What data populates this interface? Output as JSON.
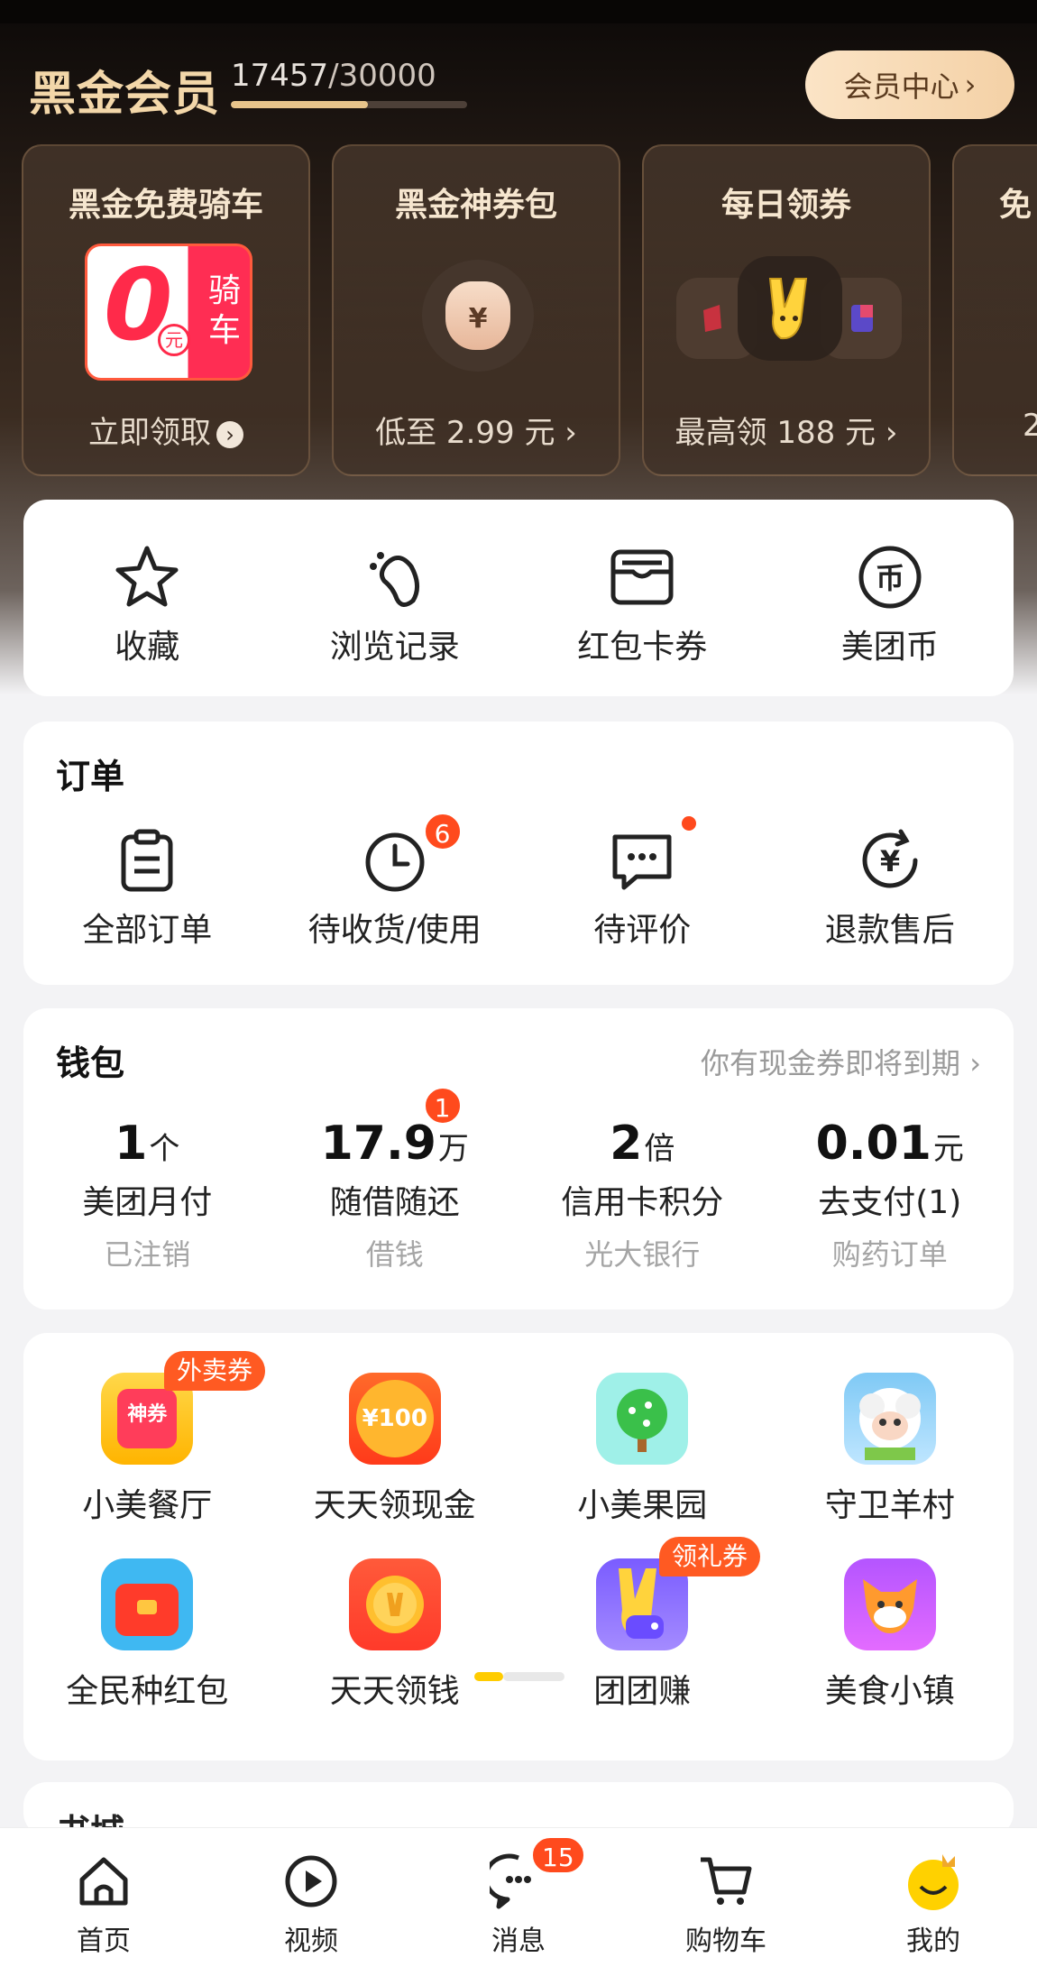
{
  "membership": {
    "title": "黑金会员",
    "progress_current": "17457",
    "progress_total": "/30000",
    "progress_fraction": 0.58,
    "center_button": "会员中心",
    "perks": [
      {
        "title": "黑金免费骑车",
        "subtitle": "立即领取",
        "badge_zero": "0",
        "badge_yuan": "元",
        "badge_ride": "骑车"
      },
      {
        "title": "黑金神券包",
        "subtitle": "低至 2.99 元",
        "bag_symbol": "¥"
      },
      {
        "title": "每日领券",
        "subtitle": "最高领 188 元"
      },
      {
        "title": "免",
        "subtitle": "2"
      }
    ]
  },
  "quick_actions": [
    {
      "label": "收藏",
      "icon": "star-icon"
    },
    {
      "label": "浏览记录",
      "icon": "footprint-icon"
    },
    {
      "label": "红包卡券",
      "icon": "wallet-card-icon"
    },
    {
      "label": "美团币",
      "icon": "coin-icon"
    }
  ],
  "orders": {
    "title": "订单",
    "items": [
      {
        "label": "全部订单",
        "icon": "clipboard-icon"
      },
      {
        "label": "待收货/使用",
        "icon": "clock-icon",
        "badge": "6"
      },
      {
        "label": "待评价",
        "icon": "comment-icon",
        "dot": true
      },
      {
        "label": "退款售后",
        "icon": "refund-icon"
      }
    ]
  },
  "wallet": {
    "title": "钱包",
    "notice": "你有现金券即将到期",
    "items": [
      {
        "value": "1",
        "unit": "个",
        "name": "美团月付",
        "sub": "已注销"
      },
      {
        "value": "17.9",
        "unit": "万",
        "name": "随借随还",
        "sub": "借钱",
        "badge": "1"
      },
      {
        "value": "2",
        "unit": "倍",
        "name": "信用卡积分",
        "sub": "光大银行"
      },
      {
        "value": "0.01",
        "unit": "元",
        "name": "去支付(1)",
        "sub": "购药订单"
      }
    ]
  },
  "apps": [
    {
      "name": "小美餐厅",
      "tag": "外卖券",
      "icon_text": "神券"
    },
    {
      "name": "天天领现金",
      "icon_text": "¥100"
    },
    {
      "name": "小美果园"
    },
    {
      "name": "守卫羊村"
    },
    {
      "name": "全民种红包"
    },
    {
      "name": "天天领钱"
    },
    {
      "name": "团团赚",
      "tag": "领礼券"
    },
    {
      "name": "美食小镇"
    }
  ],
  "next_section": {
    "title": "书城"
  },
  "tabbar": [
    {
      "label": "首页",
      "icon": "home-icon"
    },
    {
      "label": "视频",
      "icon": "video-play-icon"
    },
    {
      "label": "消息",
      "icon": "message-icon",
      "badge": "15"
    },
    {
      "label": "购物车",
      "icon": "cart-icon"
    },
    {
      "label": "我的",
      "icon": "profile-face-icon"
    }
  ],
  "colors": {
    "accent_orange": "#ff4a1d",
    "gold": "#f3d7a9",
    "brand_yellow": "#ffcc00"
  }
}
